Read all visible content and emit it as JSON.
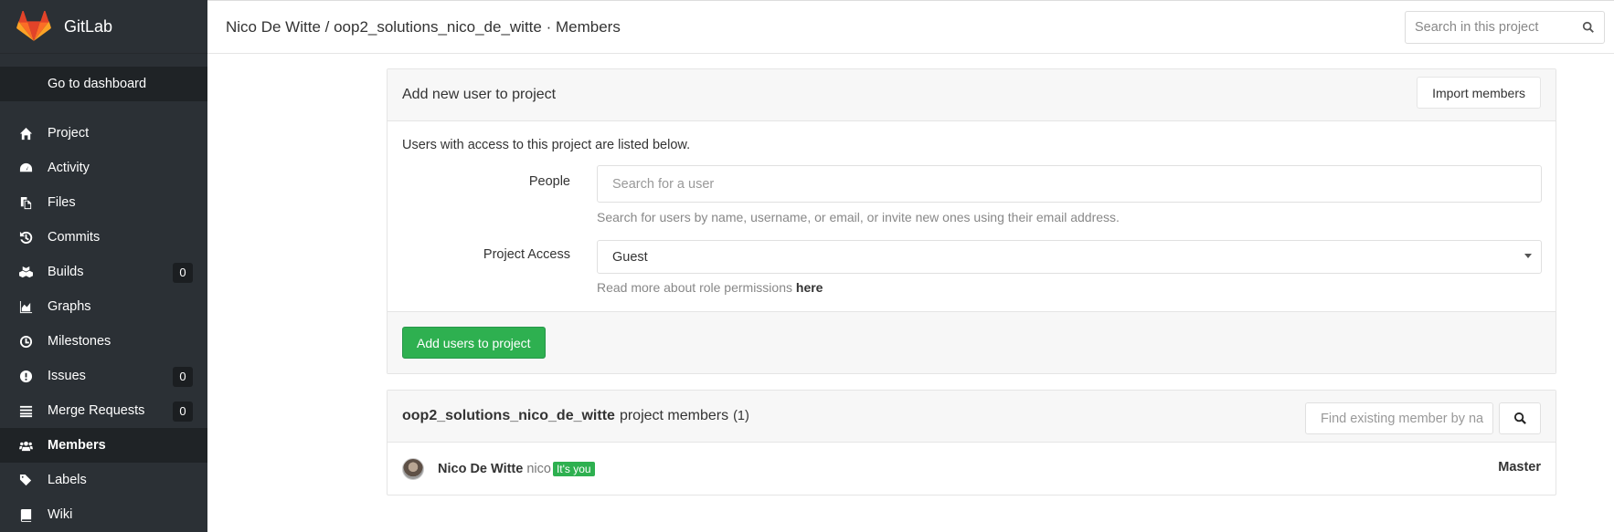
{
  "brand": {
    "name": "GitLab",
    "logo_color": "#fc6d26"
  },
  "sidebar": {
    "dashboard_label": "Go to dashboard",
    "items": [
      {
        "label": "Project",
        "icon": "home-icon"
      },
      {
        "label": "Activity",
        "icon": "dashboard-icon"
      },
      {
        "label": "Files",
        "icon": "files-icon"
      },
      {
        "label": "Commits",
        "icon": "history-icon"
      },
      {
        "label": "Builds",
        "icon": "cubes-icon",
        "count": "0"
      },
      {
        "label": "Graphs",
        "icon": "area-chart-icon"
      },
      {
        "label": "Milestones",
        "icon": "clock-icon"
      },
      {
        "label": "Issues",
        "icon": "exclamation-circle-icon",
        "count": "0"
      },
      {
        "label": "Merge Requests",
        "icon": "list-icon",
        "count": "0"
      },
      {
        "label": "Members",
        "icon": "users-icon",
        "active": true
      },
      {
        "label": "Labels",
        "icon": "tags-icon"
      },
      {
        "label": "Wiki",
        "icon": "book-icon"
      }
    ]
  },
  "header": {
    "breadcrumb": "Nico De Witte / oop2_solutions_nico_de_witte · Members",
    "search_placeholder": "Search in this project"
  },
  "add_panel": {
    "title": "Add new user to project",
    "import_label": "Import members",
    "intro": "Users with access to this project are listed below.",
    "people_label": "People",
    "people_placeholder": "Search for a user",
    "people_help": "Search for users by name, username, or email, or invite new ones using their email address.",
    "access_label": "Project Access",
    "access_value": "Guest",
    "access_help": "Read more about role permissions",
    "access_help_link": "here",
    "submit_label": "Add users to project"
  },
  "members_panel": {
    "project_name": "oop2_solutions_nico_de_witte",
    "title_suffix": "project members",
    "count": "(1)",
    "find_placeholder": "Find existing member by na",
    "members": [
      {
        "name": "Nico De Witte",
        "username": "nico",
        "badge": "It's you",
        "role": "Master"
      }
    ]
  }
}
